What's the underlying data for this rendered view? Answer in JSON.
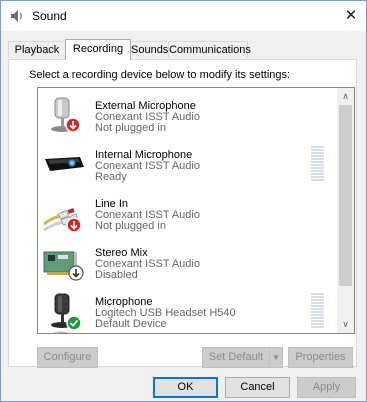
{
  "window": {
    "title": "Sound",
    "close_label": "✕"
  },
  "tabs": [
    {
      "label": "Playback"
    },
    {
      "label": "Recording",
      "active": true
    },
    {
      "label": "Sounds"
    },
    {
      "label": "Communications"
    }
  ],
  "instructions": "Select a recording device below to modify its settings:",
  "devices": [
    {
      "name": "External Microphone",
      "driver": "Conexant ISST Audio",
      "status": "Not plugged in",
      "icon": "microphone-icon",
      "badge": "unplugged-badge-icon"
    },
    {
      "name": "Internal Microphone",
      "driver": "Conexant ISST Audio",
      "status": "Ready",
      "icon": "internal-microphone-icon",
      "badge": ""
    },
    {
      "name": "Line In",
      "driver": "Conexant ISST Audio",
      "status": "Not plugged in",
      "icon": "line-in-cable-icon",
      "badge": "unplugged-badge-icon"
    },
    {
      "name": "Stereo Mix",
      "driver": "Conexant ISST Audio",
      "status": "Disabled",
      "icon": "sound-card-icon",
      "badge": "disabled-badge-icon"
    },
    {
      "name": "Microphone",
      "driver": "Logitech USB Headset H540",
      "status": "Default Device",
      "icon": "headset-microphone-icon",
      "badge": "default-checkmark-icon"
    }
  ],
  "buttons": {
    "configure": "Configure",
    "set_default": "Set Default",
    "set_default_arrow": "▼",
    "properties": "Properties",
    "ok": "OK",
    "cancel": "Cancel",
    "apply": "Apply"
  },
  "scrollbar": {
    "up": "∧",
    "down": "∨"
  },
  "colors": {
    "window_border": "#7a9ec9",
    "default_button_border": "#0078d7",
    "checkmark_green": "#1a9a3c",
    "badge_red": "#d0282a",
    "disabled_text": "#8b8b8b"
  }
}
